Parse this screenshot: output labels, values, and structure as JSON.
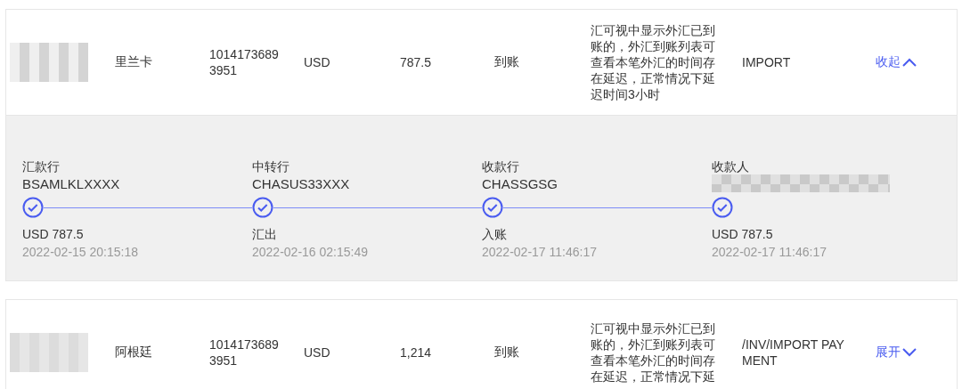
{
  "transactions": [
    {
      "country": "里兰卡",
      "account": "10141736893951",
      "currency": "USD",
      "amount": "787.5",
      "status": "到账",
      "note": "汇可视中显示外汇已到账的，外汇到账列表可查看本笔外汇的时间存在延迟，正常情况下延迟时间3小时",
      "remarks": "IMPORT",
      "toggle": {
        "label": "收起",
        "expanded": true
      },
      "route": [
        {
          "role": "汇款行",
          "code": "BSAMLKLXXXX",
          "completed": true,
          "event": "USD 787.5",
          "time": "2022-02-15 20:15:18"
        },
        {
          "role": "中转行",
          "code": "CHASUS33XXX",
          "completed": true,
          "event": "汇出",
          "time": "2022-02-16 02:15:49"
        },
        {
          "role": "收款行",
          "code": "CHASSGSG",
          "completed": true,
          "event": "入账",
          "time": "2022-02-17 11:46:17"
        },
        {
          "role": "收款人",
          "completed": true,
          "event": "USD 787.5",
          "time": "2022-02-17 11:46:17"
        }
      ]
    },
    {
      "country": "阿根廷",
      "account": "10141736893951",
      "currency": "USD",
      "amount": "1,214",
      "status": "到账",
      "note": "汇可视中显示外汇已到账的，外汇到账列表可查看本笔外汇的时间存在延迟，正常情况下延",
      "remarks": "/INV/IMPORT PAYMENT",
      "toggle": {
        "label": "展开",
        "expanded": false
      }
    }
  ]
}
